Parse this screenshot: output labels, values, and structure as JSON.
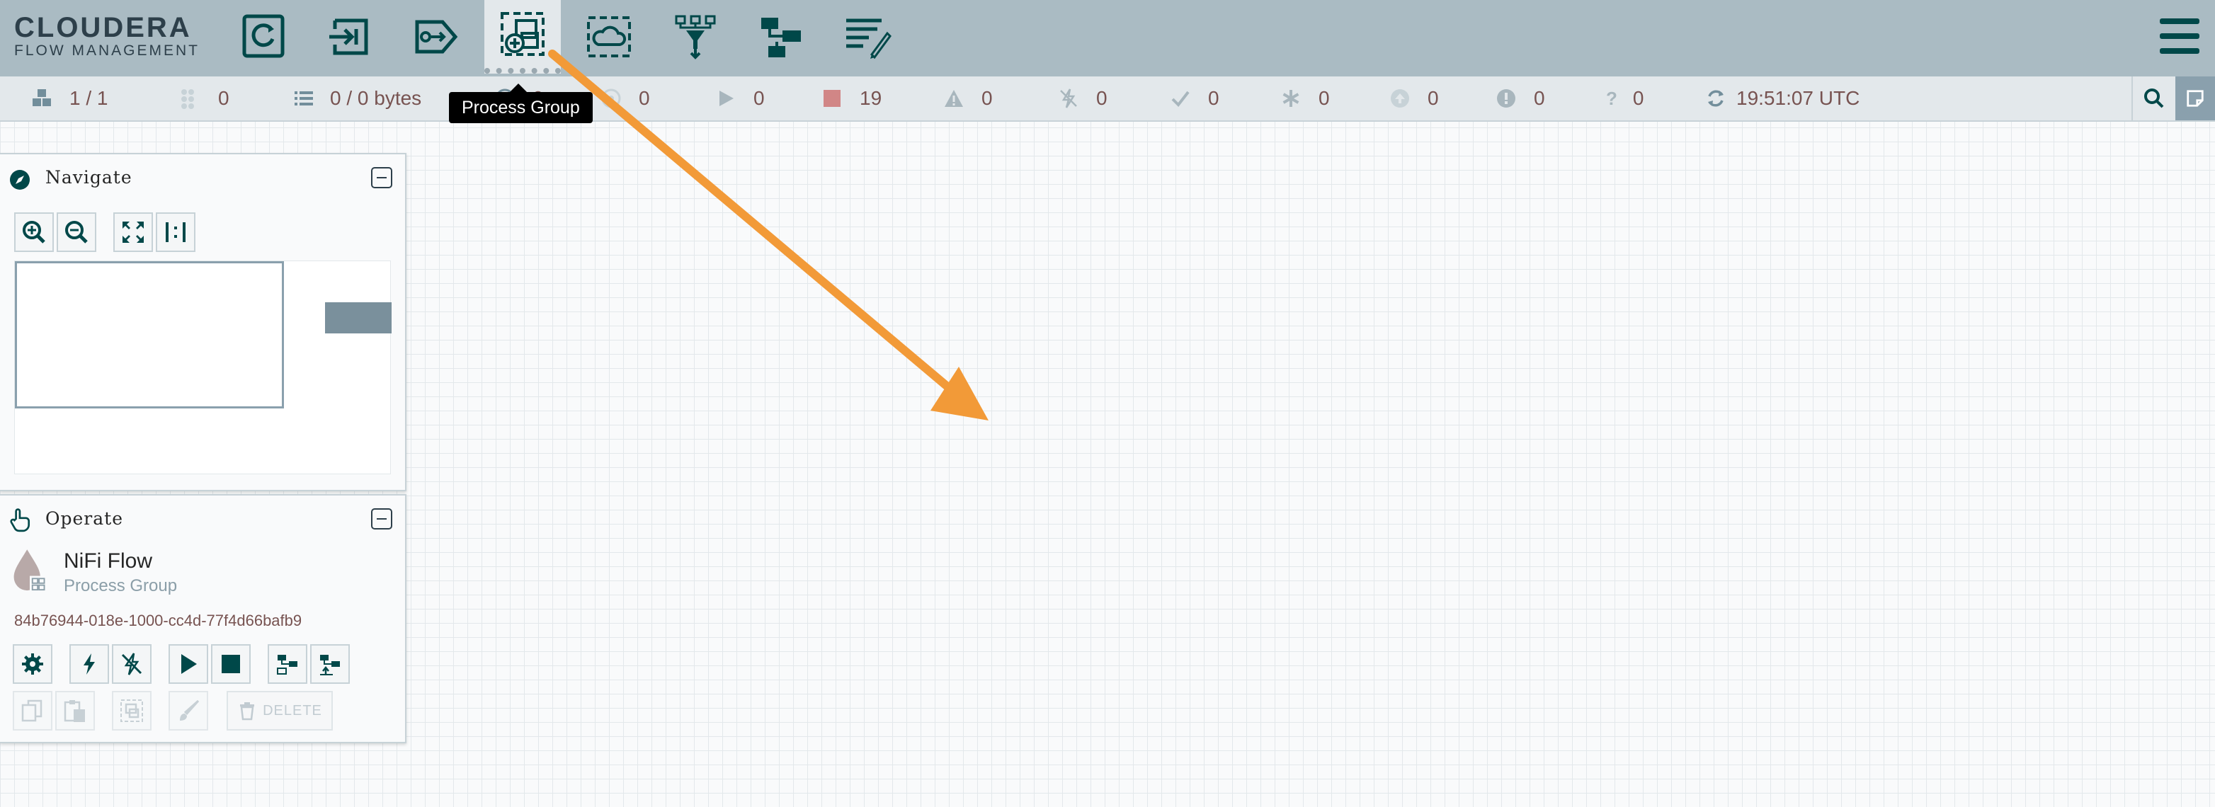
{
  "header": {
    "logo_main": "CLOUDERA",
    "logo_sub": "FLOW MANAGEMENT",
    "toolbar": [
      {
        "name": "processor-tool",
        "icon": "processor-icon"
      },
      {
        "name": "input-port-tool",
        "icon": "input-port-icon"
      },
      {
        "name": "output-port-tool",
        "icon": "output-port-icon"
      },
      {
        "name": "process-group-tool",
        "icon": "process-group-icon",
        "active": true
      },
      {
        "name": "remote-process-group-tool",
        "icon": "remote-process-group-icon"
      },
      {
        "name": "funnel-tool",
        "icon": "funnel-icon"
      },
      {
        "name": "template-tool",
        "icon": "template-icon"
      },
      {
        "name": "label-tool",
        "icon": "label-icon"
      }
    ]
  },
  "status": {
    "active_threads": "1 / 1",
    "total_queued_flowfiles": "0",
    "queued_bytes": "0 / 0 bytes",
    "transmitting": "0",
    "not_transmitting": "0",
    "running": "0",
    "stopped": "19",
    "invalid": "0",
    "disabled": "0",
    "up_to_date": "0",
    "locally_modified": "0",
    "stale": "0",
    "locally_modified_and_stale": "0",
    "sync_failure": "0",
    "last_refreshed": "19:51:07 UTC"
  },
  "tooltip": {
    "text": "Process Group"
  },
  "navigate": {
    "title": "Navigate"
  },
  "operate": {
    "title": "Operate",
    "name": "NiFi Flow",
    "type": "Process Group",
    "id": "84b76944-018e-1000-cc4d-77f4d66bafb9",
    "delete_label": "DELETE"
  },
  "colors": {
    "header_bg": "#aabbc3",
    "icon_dark": "#004849",
    "stat_text": "#775351",
    "stopped_red": "#d18686",
    "arrow_orange": "#f29a38"
  }
}
